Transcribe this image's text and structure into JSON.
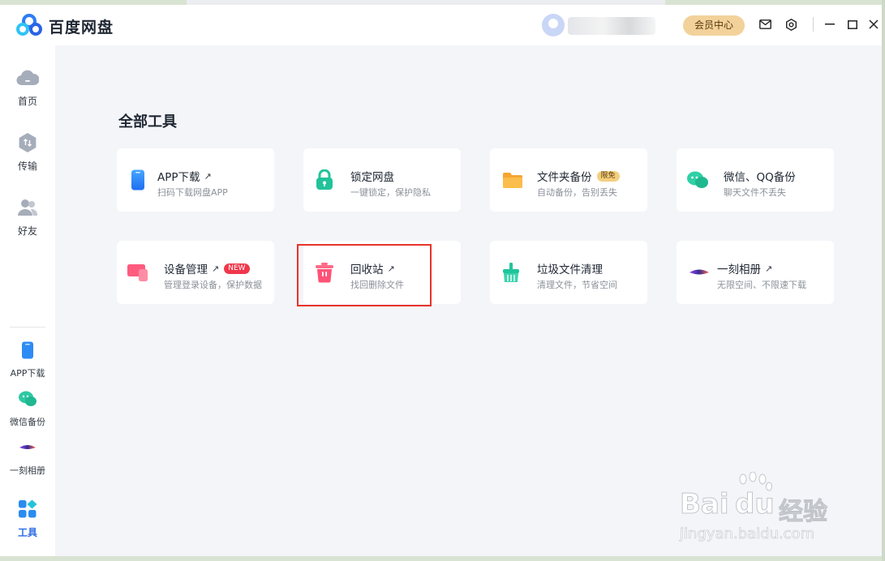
{
  "app": {
    "title": "百度网盘"
  },
  "header": {
    "vip_label": "会员中心"
  },
  "sidebar": {
    "items": [
      {
        "label": "首页",
        "icon": "cloud-home-icon"
      },
      {
        "label": "传输",
        "icon": "transfer-icon"
      },
      {
        "label": "好友",
        "icon": "friends-icon"
      },
      {
        "label": "APP下载",
        "icon": "phone-icon"
      },
      {
        "label": "微信备份",
        "icon": "wechat-icon"
      },
      {
        "label": "一刻相册",
        "icon": "yike-album-icon"
      },
      {
        "label": "工具",
        "icon": "tools-grid-icon",
        "active": true
      }
    ]
  },
  "main": {
    "section_title": "全部工具",
    "tools": [
      {
        "title": "APP下载",
        "subtitle": "扫码下载网盘APP",
        "external": true,
        "icon": "phone-icon"
      },
      {
        "title": "锁定网盘",
        "subtitle": "一键锁定，保护隐私",
        "icon": "lock-icon"
      },
      {
        "title": "文件夹备份",
        "subtitle": "自动备份，告别丢失",
        "badge": "限免",
        "icon": "folder-icon"
      },
      {
        "title": "微信、QQ备份",
        "subtitle": "聊天文件不丢失",
        "icon": "chat-bubble-icon"
      },
      {
        "title": "设备管理",
        "subtitle": "管理登录设备，保护数据",
        "external": true,
        "badge": "NEW",
        "icon": "devices-icon"
      },
      {
        "title": "回收站",
        "subtitle": "找回删除文件",
        "external": true,
        "icon": "recycle-bin-icon"
      },
      {
        "title": "垃圾文件清理",
        "subtitle": "清理文件，节省空间",
        "icon": "broom-icon"
      },
      {
        "title": "一刻相册",
        "subtitle": "无限空间、不限速下载",
        "external": true,
        "icon": "yike-album-icon"
      }
    ],
    "external_arrow": "↗"
  },
  "watermark": {
    "brand": "Bai",
    "brand2": "du",
    "cn": "经验",
    "url": "jingyan.baidu.com"
  },
  "colors": {
    "accent": "#2b6be6",
    "highlight": "#e8322c",
    "vip": "#f2d29a",
    "new_badge": "#f0374b"
  }
}
